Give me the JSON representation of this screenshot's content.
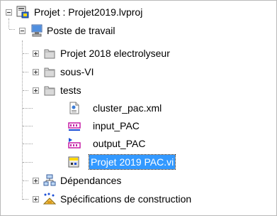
{
  "tree": {
    "project": {
      "label": "Projet : Projet2019.lvproj",
      "icon": "labview-project-icon"
    },
    "workstation": {
      "label": "Poste de travail",
      "icon": "computer-icon"
    },
    "items": [
      {
        "label": "Projet 2018 electrolyseur",
        "icon": "folder-icon"
      },
      {
        "label": "sous-VI",
        "icon": "folder-icon"
      },
      {
        "label": "tests",
        "icon": "folder-icon"
      },
      {
        "label": "cluster_pac.xml",
        "icon": "xml-file-icon"
      },
      {
        "label": "input_PAC",
        "icon": "shared-variable-input-icon"
      },
      {
        "label": "output_PAC",
        "icon": "shared-variable-output-icon"
      },
      {
        "label": "Projet 2019 PAC.vi",
        "icon": "vi-file-icon",
        "selected": true
      },
      {
        "label": "Dépendances",
        "icon": "dependencies-icon"
      },
      {
        "label": "Spécifications de construction",
        "icon": "build-specifications-icon"
      }
    ]
  },
  "colors": {
    "selection": "#3399ff",
    "folder": "#c9c9c9",
    "border": "#b9b9b9"
  }
}
